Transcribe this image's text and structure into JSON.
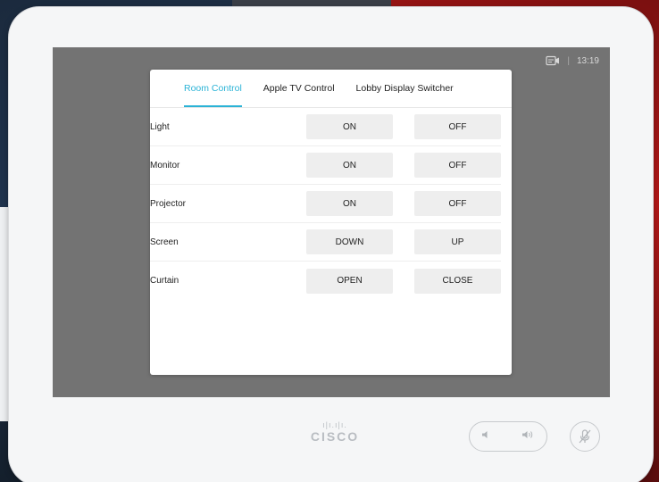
{
  "status": {
    "time": "13:19",
    "separator": "|",
    "camera_icon": "camera-icon"
  },
  "tabs": [
    {
      "label": "Room Control",
      "active": true
    },
    {
      "label": "Apple TV Control",
      "active": false
    },
    {
      "label": "Lobby Display Switcher",
      "active": false
    }
  ],
  "rows": [
    {
      "label": "Light",
      "btn1": "ON",
      "btn2": "OFF"
    },
    {
      "label": "Monitor",
      "btn1": "ON",
      "btn2": "OFF"
    },
    {
      "label": "Projector",
      "btn1": "ON",
      "btn2": "OFF"
    },
    {
      "label": "Screen",
      "btn1": "DOWN",
      "btn2": "UP"
    },
    {
      "label": "Curtain",
      "btn1": "OPEN",
      "btn2": "CLOSE"
    }
  ],
  "brand": {
    "name": "CISCO",
    "logo_bars": "ı|ı.ı|ı."
  },
  "colors": {
    "accent": "#2bb3d6",
    "screen_bg": "#737373",
    "button_bg": "#eeeeee"
  },
  "icons": {
    "volume_down": "volume-down-icon",
    "volume_up": "volume-up-icon",
    "mic_muted": "mic-muted-icon"
  }
}
